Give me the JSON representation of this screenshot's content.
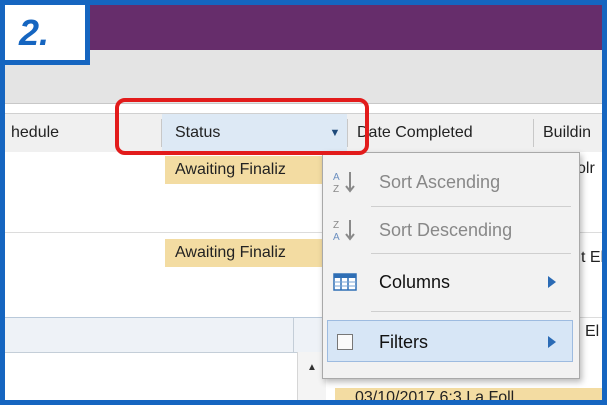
{
  "step_badge": {
    "text": "2."
  },
  "columns": {
    "schedule": "hedule",
    "status": "Status",
    "date_completed": "Date Completed",
    "building": "Buildin"
  },
  "rows": [
    {
      "status": "Awaiting Finaliz",
      "right_text": "olr"
    },
    {
      "status": "Awaiting Finaliz",
      "right_text": "t El"
    },
    {
      "status": "",
      "right_text": "El"
    }
  ],
  "bottom_row": {
    "text": "03/10/2017 6:3  La Foll"
  },
  "column_menu": {
    "items": [
      {
        "label": "Sort Ascending",
        "icon": "sort-ascending-icon",
        "enabled": false
      },
      {
        "label": "Sort Descending",
        "icon": "sort-descending-icon",
        "enabled": false
      },
      {
        "label": "Columns",
        "icon": "columns-icon",
        "enabled": true,
        "has_submenu": true
      },
      {
        "label": "Filters",
        "icon": "checkbox-icon",
        "enabled": true,
        "has_submenu": true,
        "hovered": true
      }
    ]
  },
  "colors": {
    "accent_blue": "#1565c0",
    "header_purple": "#662d6b",
    "status_yellow": "#f3dca2",
    "callout_red": "#e21b1b",
    "hover_blue": "#d7e6f6"
  }
}
